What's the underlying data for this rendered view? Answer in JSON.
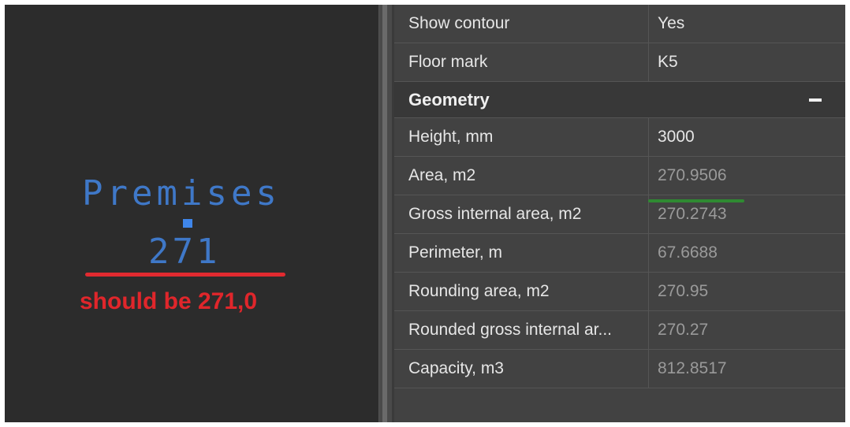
{
  "canvas": {
    "premises_label": "Premises",
    "area_label": "271",
    "annotation": "should be 271,0"
  },
  "properties": {
    "rows_top": [
      {
        "name": "Show contour",
        "value": "Yes"
      },
      {
        "name": "Floor mark",
        "value": "K5"
      }
    ],
    "group": {
      "title": "Geometry",
      "collapse_glyph": "—"
    },
    "geometry_rows": [
      {
        "name": "Height, mm",
        "value": "3000",
        "editable": true
      },
      {
        "name": "Area, m2",
        "value": "270.9506",
        "editable": false
      },
      {
        "name": "Gross internal area, m2",
        "value": "270.2743",
        "editable": false
      },
      {
        "name": "Perimeter, m",
        "value": "67.6688",
        "editable": false
      },
      {
        "name": "Rounding area, m2",
        "value": "270.95",
        "editable": false
      },
      {
        "name": "Rounded gross internal ar...",
        "value": "270.27",
        "editable": false
      },
      {
        "name": "Capacity, m3",
        "value": "812.8517",
        "editable": false
      }
    ]
  },
  "colors": {
    "drawing_text": "#3f78c8",
    "annotation": "#e0262b",
    "highlight_underline": "#2f8a32"
  }
}
